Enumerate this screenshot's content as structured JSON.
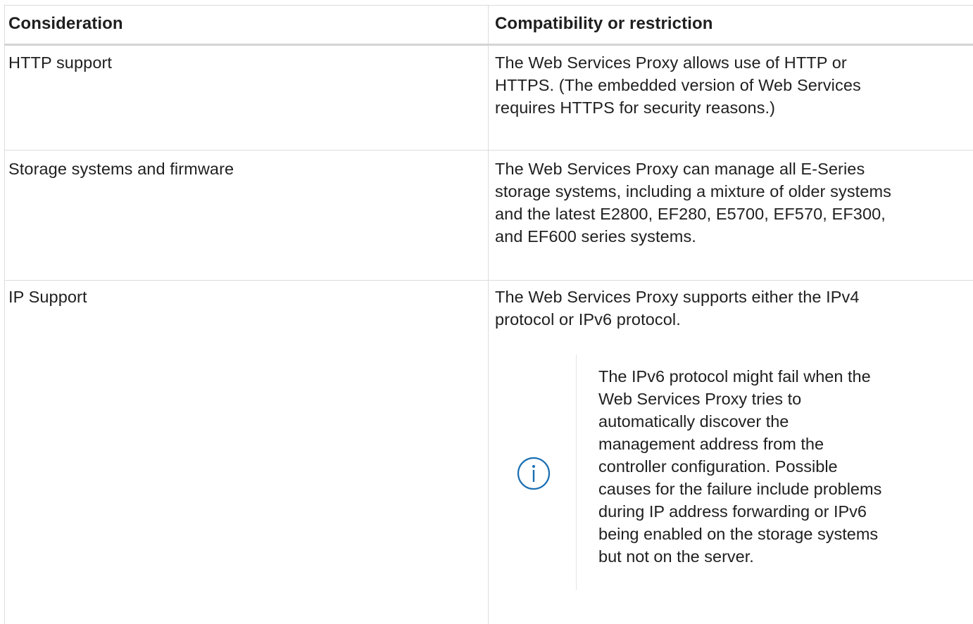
{
  "table": {
    "headers": [
      "Consideration",
      "Compatibility or restriction"
    ],
    "rows": [
      {
        "consideration": "HTTP support",
        "lines": [
          "The Web Services Proxy allows use of HTTP or",
          "HTTPS. (The embedded version of Web Services",
          "requires HTTPS for security reasons.)"
        ]
      },
      {
        "consideration": "Storage systems and firmware",
        "lines": [
          "The Web Services Proxy can manage all E-Series",
          "storage systems, including a mixture of older systems",
          "and the latest E2800, EF280, E5700, EF570, EF300,",
          "and EF600 series systems."
        ]
      },
      {
        "consideration": "IP Support",
        "lines": [
          "The Web Services Proxy supports either the IPv4",
          "protocol or IPv6 protocol."
        ],
        "note": {
          "icon": "info-icon",
          "lines": [
            "The IPv6 protocol might fail when the",
            "Web Services Proxy tries to",
            "automatically discover the",
            "management address from the",
            "controller configuration. Possible",
            "causes for the failure include problems",
            "during IP address forwarding or IPv6",
            "being enabled on the storage systems",
            "but not on the server."
          ]
        }
      }
    ]
  },
  "colors": {
    "border": "#dcdcdc",
    "info_icon": "#1a6fb4",
    "text": "#1f1f1f"
  }
}
